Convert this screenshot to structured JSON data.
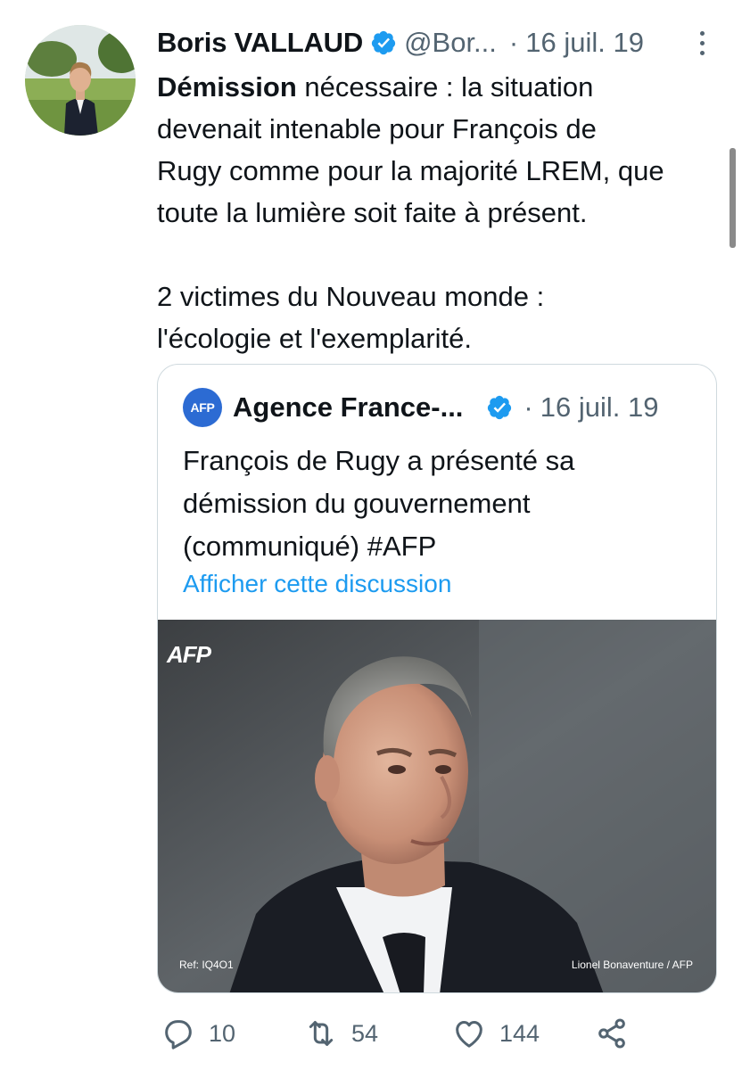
{
  "author": {
    "name": "Boris VALLAUD",
    "handle": "@Bor...",
    "date": "16 juil. 19"
  },
  "tweet": {
    "bold_lead": "Démission",
    "line1_rest": " nécessaire : la situation",
    "line2": "devenait intenable pour François de",
    "line3": "Rugy comme pour la majorité LREM, que",
    "line4": "toute la lumière soit faite à présent.",
    "line5": "2 victimes du Nouveau monde :",
    "line6": "l'écologie et l'exemplarité."
  },
  "quoted": {
    "logo_text": "AFP",
    "name": "Agence France-...",
    "date": "16 juil. 19",
    "line1": "François de Rugy a présenté sa",
    "line2": "démission du gouvernement",
    "line3": "(communiqué) #AFP",
    "link": "Afficher cette discussion",
    "photo": {
      "brand": "AFP",
      "ref": "Ref: IQ4O1",
      "credit": "Lionel Bonaventure / AFP"
    }
  },
  "actions": {
    "replies": "10",
    "retweets": "54",
    "likes": "144"
  },
  "colors": {
    "text": "#0f1419",
    "secondary": "#536471",
    "link": "#1d9bf0",
    "verified": "#1d9bf0",
    "border": "#cfd9de"
  },
  "icons": [
    "verified-icon",
    "more-icon",
    "reply-icon",
    "retweet-icon",
    "like-icon",
    "share-icon"
  ]
}
